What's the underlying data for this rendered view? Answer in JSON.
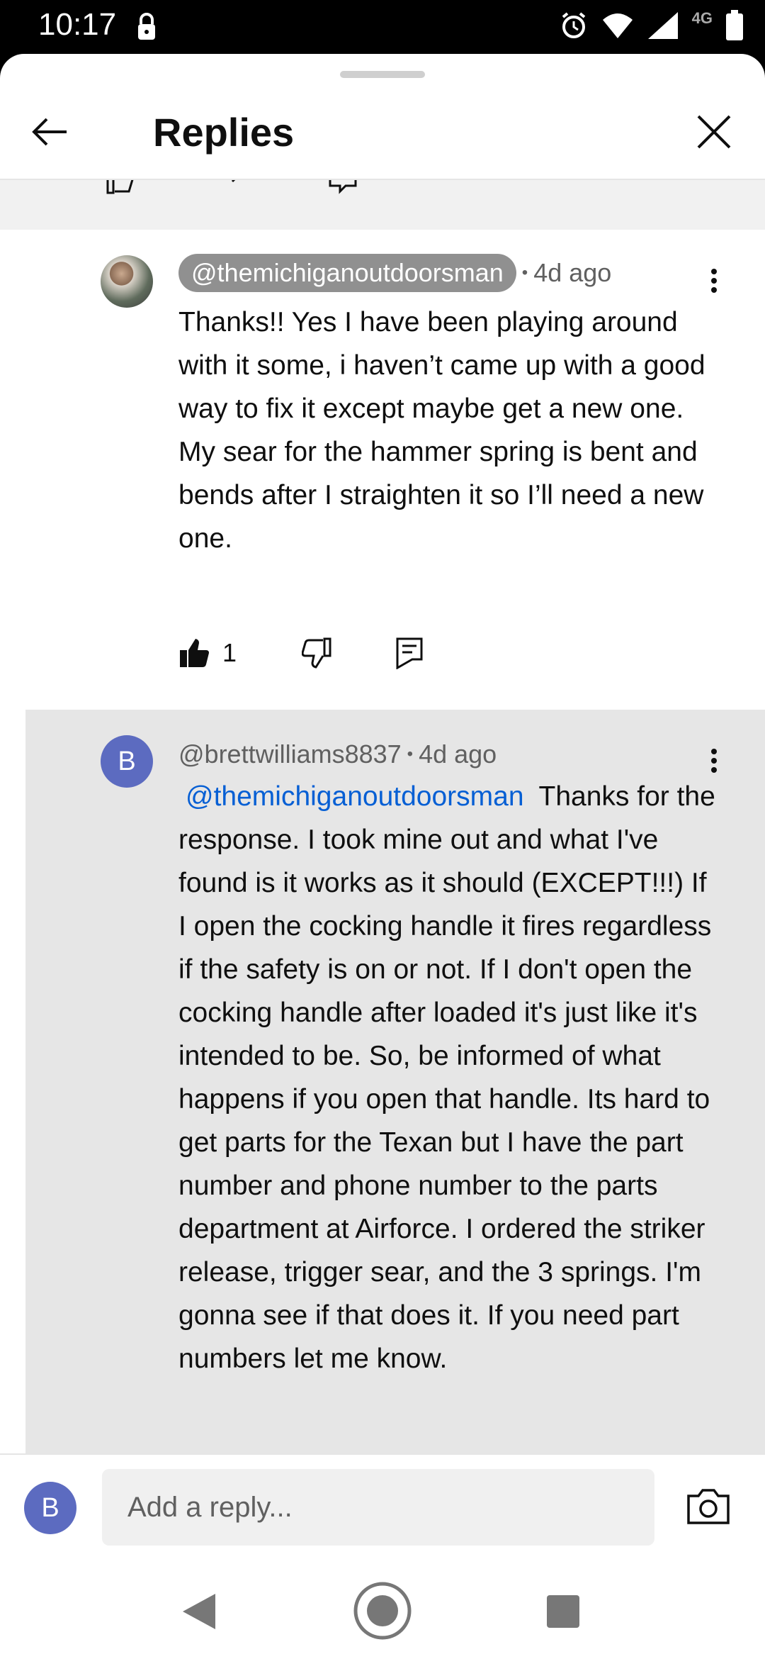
{
  "status_bar": {
    "time": "10:17",
    "network": "4G"
  },
  "header": {
    "title": "Replies"
  },
  "comments": [
    {
      "author": "@themichiganoutdoorsman",
      "time": "4d ago",
      "text": "Thanks!! Yes I have been playing around with it some, i haven’t came up with a good way to fix it except maybe get a new one. My sear for the hammer spring is bent and bends after I straighten it so I’ll need a new one.",
      "likes": "1"
    },
    {
      "author": "@brettwilliams8837",
      "avatar_letter": "B",
      "time": "4d ago",
      "mention": "@themichiganoutdoorsman",
      "text": "Thanks for the response. I took mine out and what I've found is it works as it should (EXCEPT!!!) If I open the cocking handle it fires regardless if the safety is on or not. If I don't open the cocking handle after loaded it's just like it's intended to be. So, be informed of what happens if you open that handle. Its hard to get parts for the Texan but I have the part number and phone number to the parts department at Airforce. I ordered the striker release, trigger sear, and the 3 springs. I'm gonna see if that does it. If you need part numbers let me know."
    }
  ],
  "reply_bar": {
    "avatar_letter": "B",
    "placeholder": "Add a reply..."
  },
  "colors": {
    "accent": "#065fd4",
    "avatar": "#5c6bc0",
    "highlight_bg": "#e6e6e6"
  }
}
